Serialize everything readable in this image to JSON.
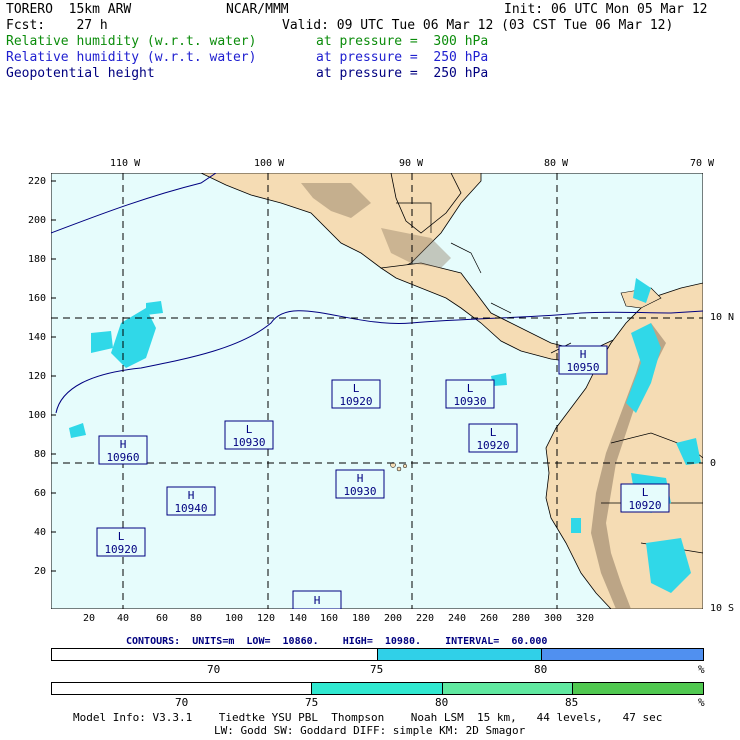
{
  "header": {
    "model": "TORERO  15km ARW",
    "org": "NCAR/MMM",
    "init": "Init: 06 UTC Mon 05 Mar 12",
    "fcst": "Fcst:    27 h",
    "valid": "Valid: 09 UTC Tue 06 Mar 12 (03 CST Tue 06 Mar 12)",
    "field1": "Relative humidity (w.r.t. water)",
    "field1_level": "at pressure =  300 hPa",
    "field2": "Relative humidity (w.r.t. water)",
    "field2_level": "at pressure =  250 hPa",
    "field3": "Geopotential height",
    "field3_level": "at pressure =  250 hPa"
  },
  "map": {
    "lon_labels": [
      "110 W",
      "100 W",
      "90 W",
      "80 W",
      "70 W"
    ],
    "lat_labels": [
      "10 N",
      "0",
      "10 S"
    ],
    "y_ticks": [
      "220",
      "200",
      "180",
      "160",
      "140",
      "120",
      "100",
      "80",
      "60",
      "40",
      "20"
    ],
    "x_ticks": [
      "20",
      "40",
      "60",
      "80",
      "100",
      "120",
      "140",
      "160",
      "180",
      "200",
      "220",
      "240",
      "260",
      "280",
      "300",
      "320"
    ],
    "markers": [
      {
        "type": "L",
        "value": "10920"
      },
      {
        "type": "L",
        "value": "10930"
      },
      {
        "type": "H",
        "value": "10950"
      },
      {
        "type": "L",
        "value": "10930"
      },
      {
        "type": "H",
        "value": "10960"
      },
      {
        "type": "L",
        "value": "10920"
      },
      {
        "type": "H",
        "value": "10930"
      },
      {
        "type": "H",
        "value": "10940"
      },
      {
        "type": "L",
        "value": "10920"
      },
      {
        "type": "L",
        "value": "10920"
      },
      {
        "type": "H",
        "value": ""
      }
    ],
    "colors": {
      "ocean": "#e6fcfc",
      "land": "#f5dcb4",
      "terrain": "#8c7860",
      "rh300": "#30d8e8",
      "rh250": "#30e8c0"
    }
  },
  "contours_text": "CONTOURS:  UNITS=m  LOW=  10860.    HIGH=  10980.    INTERVAL=  60.000",
  "bar1": {
    "labels": [
      "70",
      "75",
      "80"
    ],
    "unit": "%",
    "colors": [
      "#ffffff",
      "#30d0e8",
      "#5090f0"
    ]
  },
  "bar2": {
    "labels": [
      "70",
      "75",
      "80",
      "85"
    ],
    "unit": "%",
    "colors": [
      "#ffffff",
      "#30e8d0",
      "#60e8a0",
      "#50c850"
    ]
  },
  "footer": {
    "line1": "Model Info: V3.3.1    Tiedtke YSU PBL  Thompson    Noah LSM  15 km,   44 levels,   47 sec",
    "line2": "LW: Godd SW: Goddard DIFF: simple KM: 2D Smagor"
  }
}
